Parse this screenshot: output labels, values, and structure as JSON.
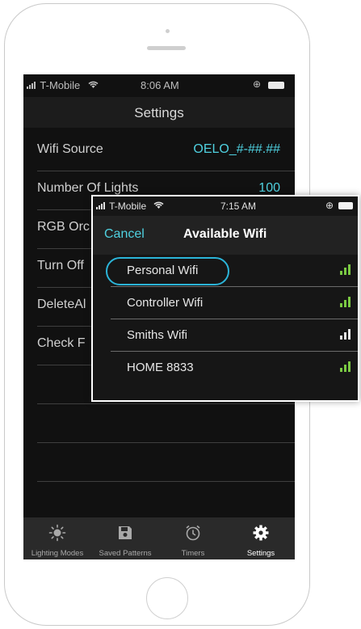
{
  "status_bar": {
    "carrier": "T-Mobile",
    "time": "8:06 AM"
  },
  "nav": {
    "title": "Settings"
  },
  "settings_rows": [
    {
      "label": "Wifi Source",
      "value": "OELO_#-##.##"
    },
    {
      "label": "Number Of Lights",
      "value": "100"
    },
    {
      "label": "RGB Orc",
      "value": ""
    },
    {
      "label": "Turn Off",
      "value": ""
    },
    {
      "label": "DeleteAl",
      "value": ""
    },
    {
      "label": "Check F",
      "value": ""
    },
    {
      "label": "",
      "value": ""
    },
    {
      "label": "",
      "value": ""
    },
    {
      "label": "",
      "value": ""
    },
    {
      "label": "",
      "value": ""
    }
  ],
  "tabs": [
    {
      "label": "Lighting Modes",
      "icon": "sun-icon"
    },
    {
      "label": "Saved Patterns",
      "icon": "save-icon"
    },
    {
      "label": "Timers",
      "icon": "alarm-clock-icon"
    },
    {
      "label": "Settings",
      "icon": "gear-icon"
    }
  ],
  "popup": {
    "status_bar": {
      "carrier": "T-Mobile",
      "time": "7:15 AM"
    },
    "cancel_label": "Cancel",
    "title": "Available Wifi",
    "networks": [
      {
        "name": "Personal Wifi"
      },
      {
        "name": "Controller Wifi"
      },
      {
        "name": "Smiths Wifi"
      },
      {
        "name": "HOME 8833"
      }
    ]
  },
  "colors": {
    "accent": "#4fd1e0",
    "signal_green": "#7ac943",
    "highlight_ring": "#2bb4d8"
  }
}
